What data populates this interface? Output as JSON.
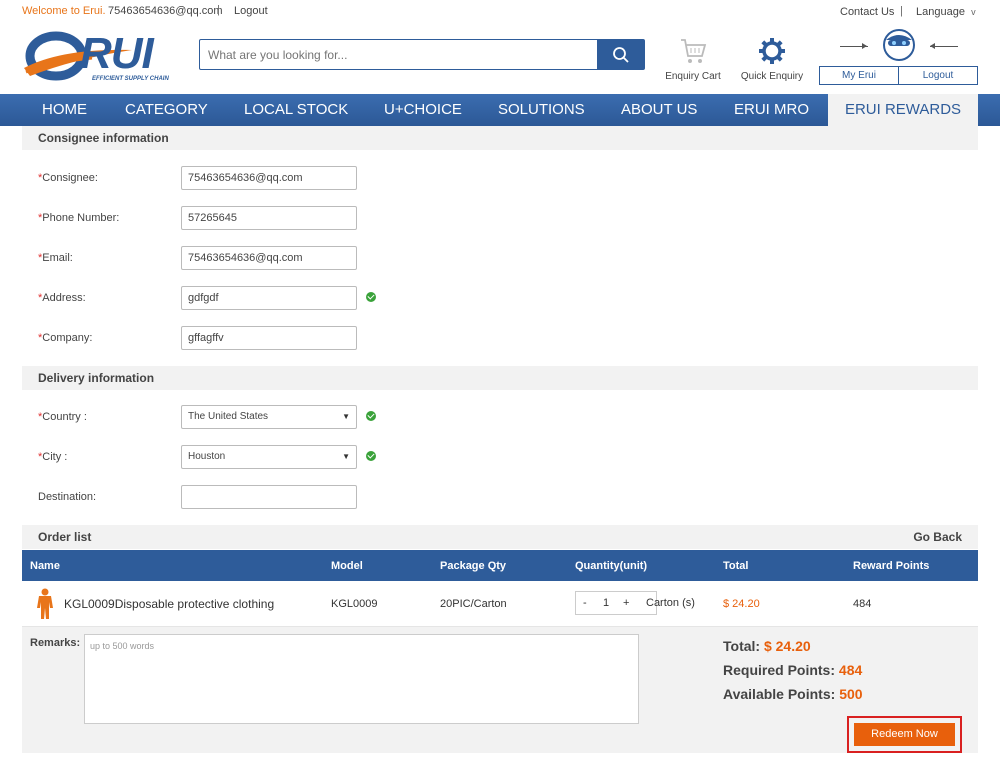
{
  "topbar": {
    "welcome": "Welcome to Erui.",
    "email": "75463654636@qq.com",
    "separator": "|",
    "logout": "Logout",
    "contact": "Contact Us",
    "language": "Language",
    "language_caret": "v"
  },
  "logo": {
    "text": "RUI",
    "tagline": "EFFICIENT SUPPLY CHAIN",
    "colors": {
      "blue": "#2e5c9a",
      "orange": "#e8751a"
    }
  },
  "search": {
    "placeholder": "What are you looking for...",
    "icon": "search-icon"
  },
  "header_actions": {
    "enquiry_cart": "Enquiry Cart",
    "quick_enquiry": "Quick Enquiry",
    "my_erui": "My Erui",
    "logout": "Logout"
  },
  "nav": {
    "items": [
      "HOME",
      "CATEGORY",
      "LOCAL STOCK",
      "U+CHOICE",
      "SOLUTIONS",
      "ABOUT US",
      "ERUI MRO",
      "ERUI REWARDS"
    ],
    "active": "ERUI REWARDS"
  },
  "consignee": {
    "heading": "Consignee information",
    "fields": [
      {
        "required": "*",
        "label": "Consignee:",
        "value": "75463654636@qq.com",
        "valid": false
      },
      {
        "required": "*",
        "label": "Phone Number:",
        "value": "57265645",
        "valid": false
      },
      {
        "required": "*",
        "label": "Email:",
        "value": "75463654636@qq.com",
        "valid": false
      },
      {
        "required": "*",
        "label": "Address:",
        "value": "gdfgdf",
        "valid": true
      },
      {
        "required": "*",
        "label": "Company:",
        "value": "gffagffv",
        "valid": false
      }
    ]
  },
  "delivery": {
    "heading": "Delivery information",
    "country": {
      "required": "*",
      "label": "Country :",
      "value": "The United States"
    },
    "city": {
      "required": "*",
      "label": "City :",
      "value": "Houston"
    },
    "destination": {
      "label": "Destination:",
      "value": ""
    }
  },
  "order": {
    "heading": "Order list",
    "go_back": "Go Back",
    "columns": [
      "Name",
      "Model",
      "Package Qty",
      "Quantity(unit)",
      "Total",
      "Reward Points"
    ],
    "row": {
      "name": "KGL0009Disposable protective clothing",
      "model": "KGL0009",
      "package_qty": "20PIC/Carton",
      "qty_minus": "-",
      "qty": "1",
      "qty_plus": "+",
      "unit": "Carton (s)",
      "total": "$ 24.20",
      "reward_points": "484"
    },
    "remarks_label": "Remarks:",
    "remarks_placeholder": "up to 500 words",
    "summary": {
      "total_label": "Total:",
      "total_value": "$ 24.20",
      "required_label": "Required Points:",
      "required_value": "484",
      "available_label": "Available Points:",
      "available_value": "500"
    },
    "redeem_button": "Redeem Now"
  }
}
